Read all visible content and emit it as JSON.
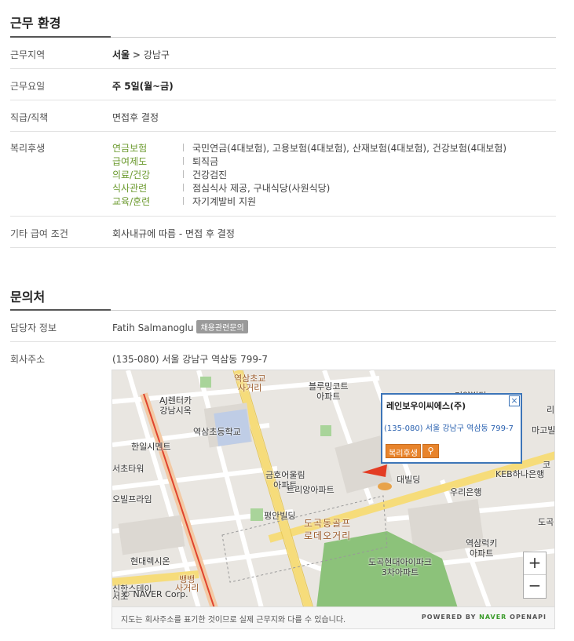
{
  "work_env": {
    "title": "근무 환경",
    "location_label": "근무지역",
    "location_city": "서울",
    "location_sep": ">",
    "location_district": "강남구",
    "days_label": "근무요일",
    "days_value": "주 5일(월~금)",
    "position_label": "직급/직책",
    "position_value": "면접후 결정",
    "benefits_label": "복리후생",
    "benefits": [
      {
        "category": "연금보험",
        "value": "국민연금(4대보험), 고용보험(4대보험), 산재보험(4대보험), 건강보험(4대보험)"
      },
      {
        "category": "급여제도",
        "value": "퇴직금"
      },
      {
        "category": "의료/건강",
        "value": "건강검진"
      },
      {
        "category": "식사관련",
        "value": "점심식사 제공, 구내식당(사원식당)"
      },
      {
        "category": "교육/훈련",
        "value": "자기계발비 지원"
      }
    ],
    "salary_label": "기타 급여 조건",
    "salary_value": "회사내규에 따름 - 면접 후 결정"
  },
  "contact": {
    "title": "문의처",
    "manager_label": "담당자 정보",
    "manager_name": "Fatih Salmanoglu",
    "manager_badge": "채용관련문의",
    "address_label": "회사주소",
    "address_value": "(135-080) 서울 강남구 역삼동 799-7"
  },
  "map": {
    "labels": {
      "yeoksam_school_intersection": "역삼초교\n사거리",
      "bluming": "블루밍코트\n아파트",
      "aj": "AJ렌터카\n강남시옥",
      "yeoksam_school": "역삼초등학교",
      "hanil": "한일시멘트",
      "seocho_tower": "서초타워",
      "officeplace": "오빌프라임",
      "kumho": "금호어울림\n아파트",
      "trivian": "트리앙아파트",
      "pyeongan": "평안빌딩",
      "golf_road": "도곡동골프\n로데오거리",
      "hyundai_rex": "현대렉시온",
      "dogok_hyundai": "도곡현대아이파크\n3차아파트",
      "yeoksam_ruky": "역삼럭키\n아파트",
      "woori": "우리은행",
      "keb": "KEB하나은행",
      "building": "대빌딩",
      "bbangbbang": "뱅뱅\n사거리",
      "shinan": "신한스테이\n서초",
      "dogok": "도곡",
      "mago": "마고빌",
      "ri": "리",
      "geoyang": "거양빌딩",
      "ko": "코"
    },
    "popup_name": "레인보우이씨에스(주)",
    "popup_address": "(135-080) 서울 강남구 역삼동 799-7",
    "popup_tag": "복리후생",
    "popup_close": "×",
    "zoom_in": "+",
    "zoom_out": "−",
    "copyright": "© NAVER Corp.",
    "footer_note": "지도는 회사주소를 표기한 것이므로 실제 근무지와 다를 수 있습니다.",
    "footer_powered": "POWERED BY",
    "footer_naver": "NAVER",
    "footer_openapi": "OPENAPI"
  }
}
